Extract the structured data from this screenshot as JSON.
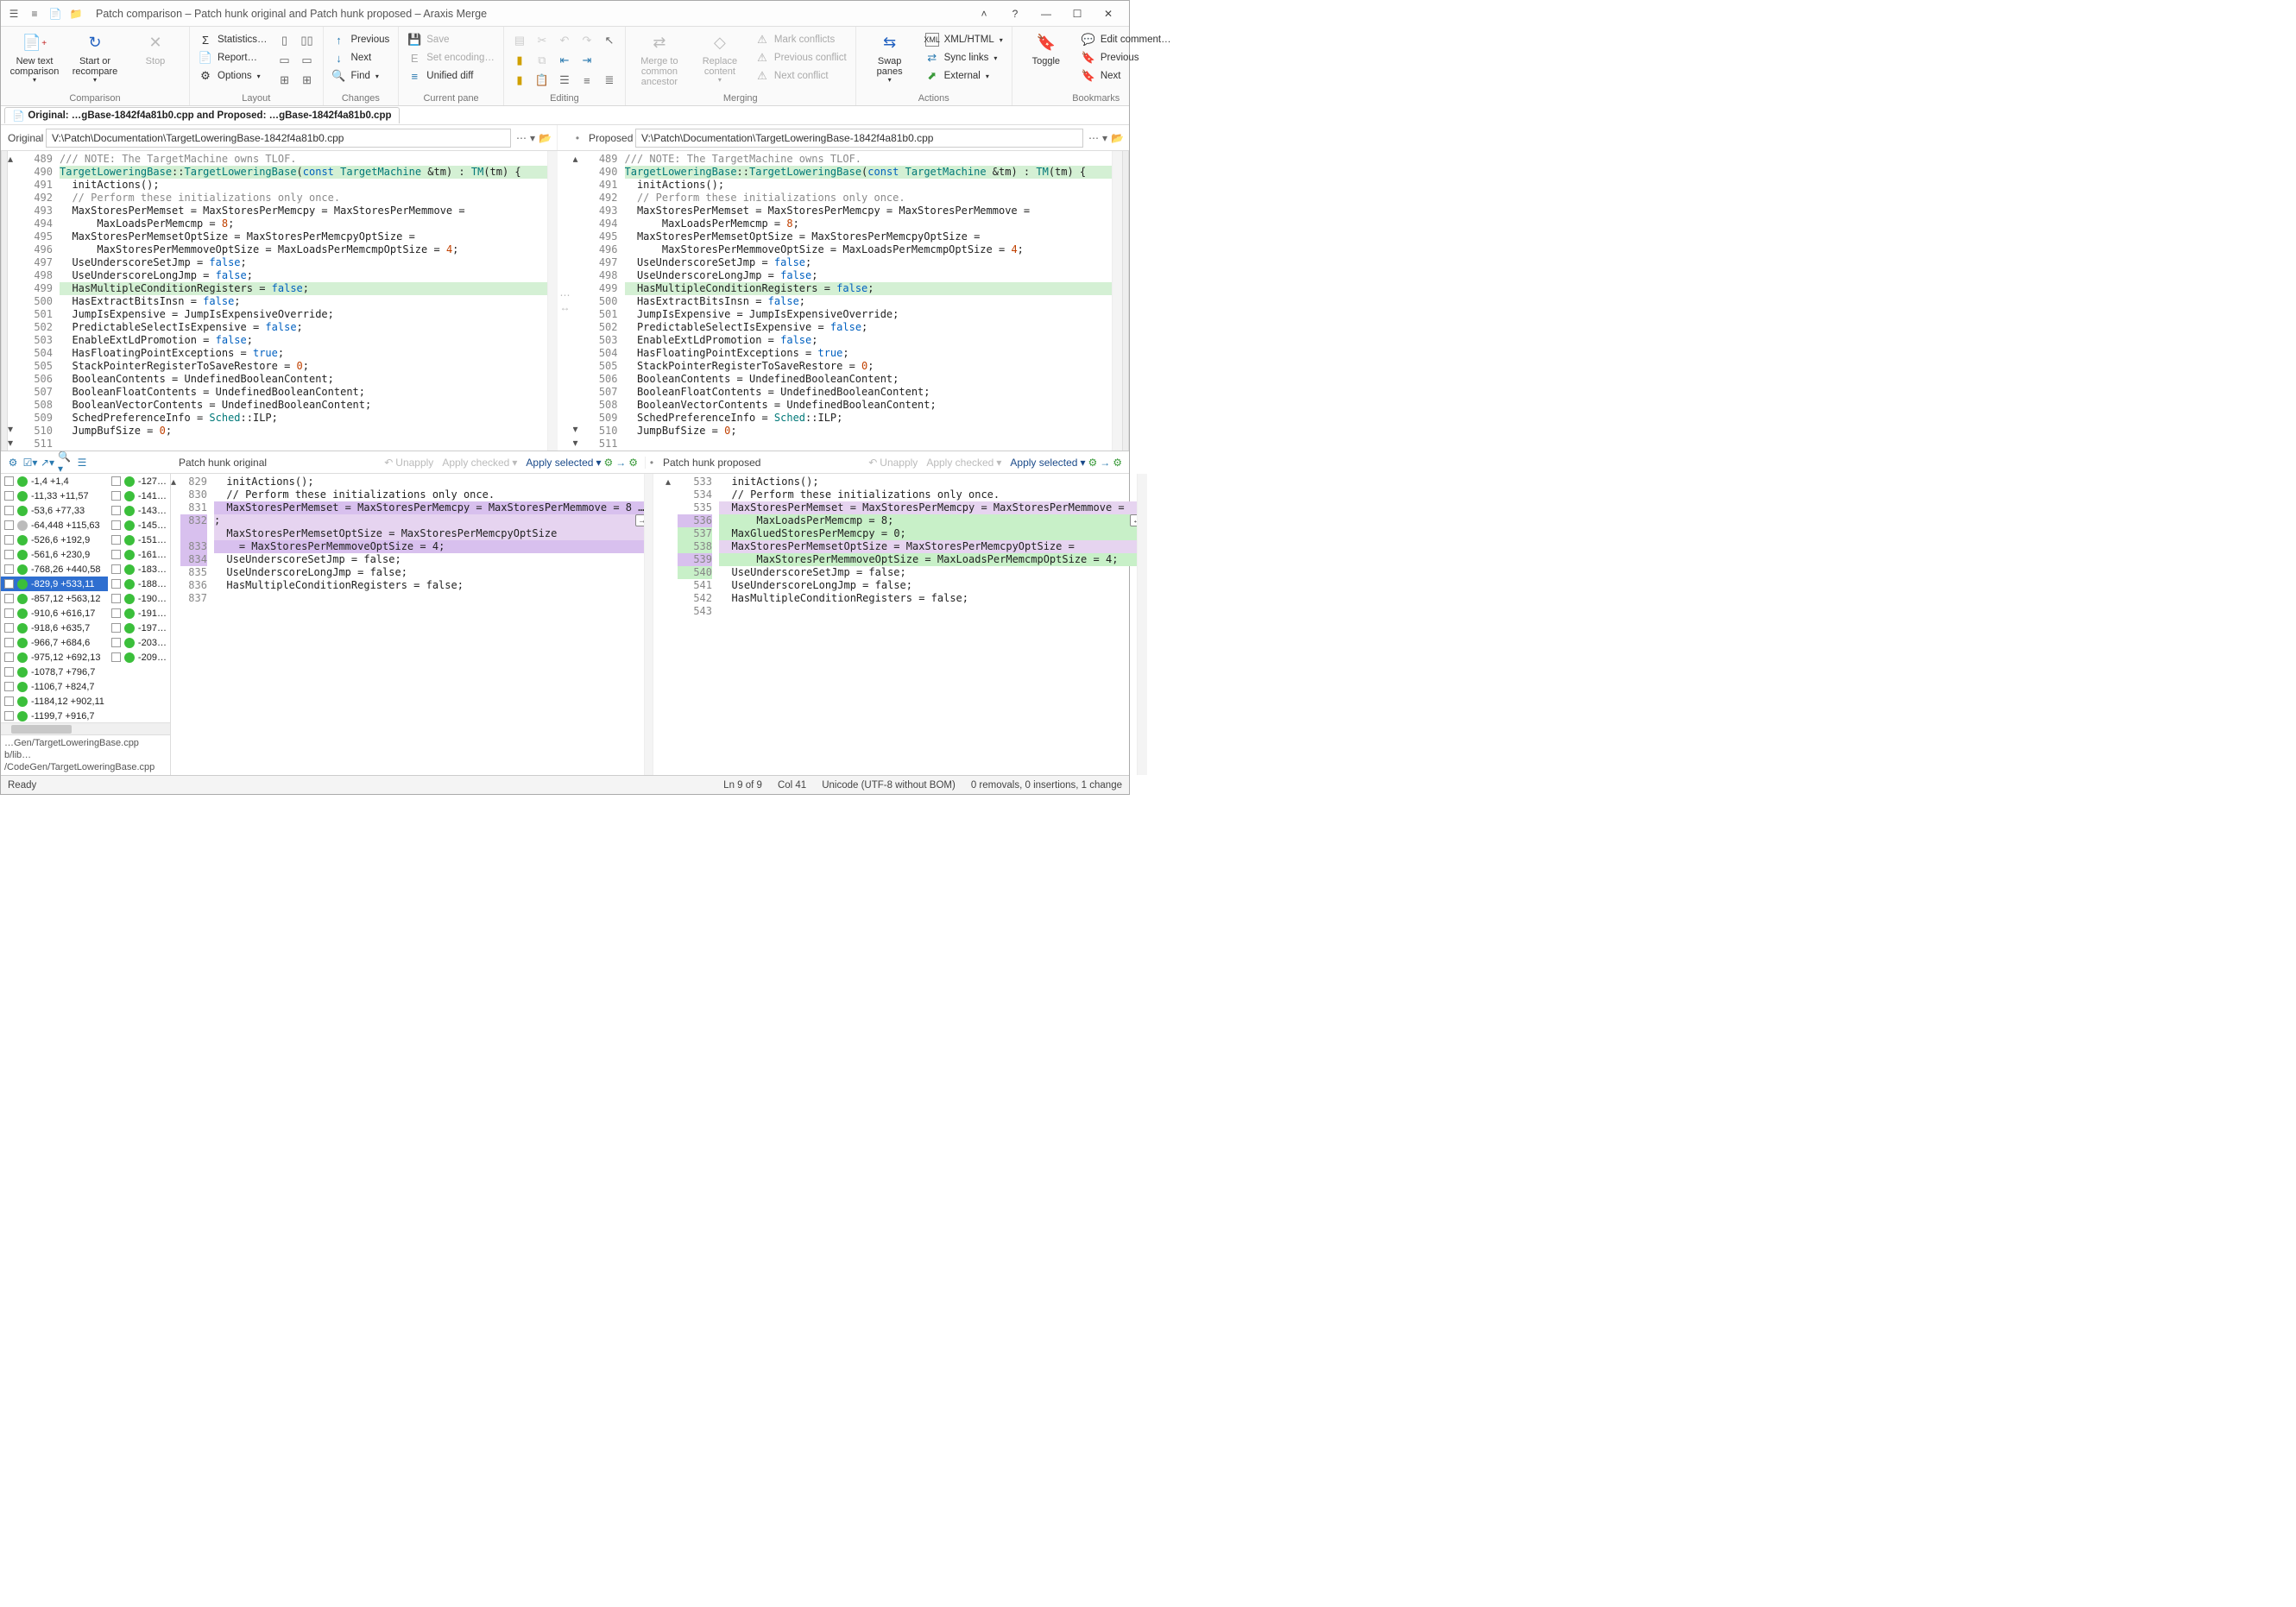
{
  "window_title": "Patch comparison – Patch hunk original and Patch hunk proposed – Araxis Merge",
  "ribbon": {
    "comparison": {
      "label": "Comparison",
      "new_text": "New text\ncomparison",
      "start_recompare": "Start or\nrecompare",
      "stop": "Stop"
    },
    "layout": {
      "label": "Layout",
      "statistics": "Statistics…",
      "report": "Report…",
      "options": "Options"
    },
    "changes": {
      "label": "Changes",
      "previous": "Previous",
      "next": "Next",
      "find": "Find"
    },
    "currentpane": {
      "label": "Current pane",
      "save": "Save",
      "set_encoding": "Set encoding…",
      "unified_diff": "Unified diff"
    },
    "editing": {
      "label": "Editing"
    },
    "merging": {
      "label": "Merging",
      "merge_common": "Merge to\ncommon ancestor",
      "replace_content": "Replace\ncontent",
      "mark_conflicts": "Mark conflicts",
      "previous_conflict": "Previous conflict",
      "next_conflict": "Next conflict"
    },
    "actions": {
      "label": "Actions",
      "swap_panes": "Swap\npanes",
      "xml_html": "XML/HTML",
      "sync_links": "Sync links",
      "external": "External"
    },
    "bookmarks": {
      "label": "Bookmarks",
      "toggle": "Toggle",
      "edit_comment": "Edit comment…",
      "previous": "Previous",
      "next": "Next"
    }
  },
  "doctab": "Original: …gBase-1842f4a81b0.cpp and Proposed: …gBase-1842f4a81b0.cpp",
  "paths": {
    "original_label": "Original",
    "original_path": "V:\\Patch\\Documentation\\TargetLoweringBase-1842f4a81b0.cpp",
    "proposed_label": "Proposed",
    "proposed_path": "V:\\Patch\\Documentation\\TargetLoweringBase-1842f4a81b0.cpp"
  },
  "code_left": {
    "start": 489,
    "lines": [
      {
        "n": 489,
        "t": "/// NOTE: The TargetMachine owns TLOF.",
        "cls": "cm"
      },
      {
        "n": 490,
        "t": "TargetLoweringBase::TargetLoweringBase(const TargetMachine &tm) : TM(tm) {",
        "cls": "hlgreen"
      },
      {
        "n": 491,
        "t": "  initActions();"
      },
      {
        "n": 492,
        "t": ""
      },
      {
        "n": 493,
        "t": "  // Perform these initializations only once.",
        "cls": "cm"
      },
      {
        "n": 494,
        "t": "  MaxStoresPerMemset = MaxStoresPerMemcpy = MaxStoresPerMemmove ="
      },
      {
        "n": 495,
        "t": "      MaxLoadsPerMemcmp = 8;"
      },
      {
        "n": 496,
        "t": "  MaxStoresPerMemsetOptSize = MaxStoresPerMemcpyOptSize ="
      },
      {
        "n": 497,
        "t": "      MaxStoresPerMemmoveOptSize = MaxLoadsPerMemcmpOptSize = 4;"
      },
      {
        "n": 498,
        "t": "  UseUnderscoreSetJmp = false;"
      },
      {
        "n": 499,
        "t": "  UseUnderscoreLongJmp = false;"
      },
      {
        "n": 500,
        "t": "  HasMultipleConditionRegisters = false;",
        "cls": "hlgreen"
      },
      {
        "n": 501,
        "t": "  HasExtractBitsInsn = false;"
      },
      {
        "n": 502,
        "t": "  JumpIsExpensive = JumpIsExpensiveOverride;"
      },
      {
        "n": 503,
        "t": "  PredictableSelectIsExpensive = false;"
      },
      {
        "n": 504,
        "t": "  EnableExtLdPromotion = false;"
      },
      {
        "n": 505,
        "t": "  HasFloatingPointExceptions = true;"
      },
      {
        "n": 506,
        "t": "  StackPointerRegisterToSaveRestore = 0;"
      },
      {
        "n": 507,
        "t": "  BooleanContents = UndefinedBooleanContent;"
      },
      {
        "n": 508,
        "t": "  BooleanFloatContents = UndefinedBooleanContent;"
      },
      {
        "n": 509,
        "t": "  BooleanVectorContents = UndefinedBooleanContent;"
      },
      {
        "n": 510,
        "t": "  SchedPreferenceInfo = Sched::ILP;"
      },
      {
        "n": 511,
        "t": "  JumpBufSize = 0;"
      }
    ]
  },
  "code_right": {
    "start": 489,
    "lines": [
      {
        "n": 489,
        "t": "/// NOTE: The TargetMachine owns TLOF.",
        "cls": "cm"
      },
      {
        "n": 490,
        "t": "TargetLoweringBase::TargetLoweringBase(const TargetMachine &tm) : TM(tm) {",
        "cls": "hlgreen"
      },
      {
        "n": 491,
        "t": "  initActions();"
      },
      {
        "n": 492,
        "t": ""
      },
      {
        "n": 493,
        "t": "  // Perform these initializations only once.",
        "cls": "cm"
      },
      {
        "n": 494,
        "t": "  MaxStoresPerMemset = MaxStoresPerMemcpy = MaxStoresPerMemmove ="
      },
      {
        "n": 495,
        "t": "      MaxLoadsPerMemcmp = 8;"
      },
      {
        "n": 496,
        "t": "  MaxStoresPerMemsetOptSize = MaxStoresPerMemcpyOptSize ="
      },
      {
        "n": 497,
        "t": "      MaxStoresPerMemmoveOptSize = MaxLoadsPerMemcmpOptSize = 4;"
      },
      {
        "n": 498,
        "t": "  UseUnderscoreSetJmp = false;"
      },
      {
        "n": 499,
        "t": "  UseUnderscoreLongJmp = false;"
      },
      {
        "n": 500,
        "t": "  HasMultipleConditionRegisters = false;",
        "cls": "hlgreen"
      },
      {
        "n": 501,
        "t": "  HasExtractBitsInsn = false;"
      },
      {
        "n": 502,
        "t": "  JumpIsExpensive = JumpIsExpensiveOverride;"
      },
      {
        "n": 503,
        "t": "  PredictableSelectIsExpensive = false;"
      },
      {
        "n": 504,
        "t": "  EnableExtLdPromotion = false;"
      },
      {
        "n": 505,
        "t": "  HasFloatingPointExceptions = true;"
      },
      {
        "n": 506,
        "t": "  StackPointerRegisterToSaveRestore = 0;"
      },
      {
        "n": 507,
        "t": "  BooleanContents = UndefinedBooleanContent;"
      },
      {
        "n": 508,
        "t": "  BooleanFloatContents = UndefinedBooleanContent;"
      },
      {
        "n": 509,
        "t": "  BooleanVectorContents = UndefinedBooleanContent;"
      },
      {
        "n": 510,
        "t": "  SchedPreferenceInfo = Sched::ILP;"
      },
      {
        "n": 511,
        "t": "  JumpBufSize = 0;"
      }
    ]
  },
  "hunkbar": {
    "left_title": "Patch hunk original",
    "right_title": "Patch hunk proposed",
    "unapply": "Unapply",
    "apply_checked": "Apply checked",
    "apply_selected": "Apply selected"
  },
  "hunks_left": [
    {
      "t": "-1,4 +1,4"
    },
    {
      "t": "-11,33 +11,57"
    },
    {
      "t": "-53,6 +77,33"
    },
    {
      "t": "-64,448 +115,63",
      "gray": true
    },
    {
      "t": "-526,6 +192,9"
    },
    {
      "t": "-561,6 +230,9"
    },
    {
      "t": "-768,26 +440,58"
    },
    {
      "t": "-829,9 +533,11",
      "sel": true
    },
    {
      "t": "-857,12 +563,12"
    },
    {
      "t": "-910,6 +616,17"
    },
    {
      "t": "-918,6 +635,7"
    },
    {
      "t": "-966,7 +684,6"
    },
    {
      "t": "-975,12 +692,13"
    },
    {
      "t": "-1078,7 +796,7"
    },
    {
      "t": "-1106,7 +824,7"
    },
    {
      "t": "-1184,12 +902,11"
    },
    {
      "t": "-1199,7 +916,7"
    }
  ],
  "hunks_right": [
    {
      "t": "-127…"
    },
    {
      "t": "-141…"
    },
    {
      "t": "-143…"
    },
    {
      "t": "-145…"
    },
    {
      "t": "-151…"
    },
    {
      "t": "-161…"
    },
    {
      "t": "-183…"
    },
    {
      "t": "-188…"
    },
    {
      "t": "-190…"
    },
    {
      "t": "-191…"
    },
    {
      "t": "-197…"
    },
    {
      "t": "-203…"
    },
    {
      "t": "-209…"
    }
  ],
  "hunk_paths": {
    "a": "…Gen/TargetLoweringBase.cpp b/lib…",
    "b": "/CodeGen/TargetLoweringBase.cpp"
  },
  "hunkcode_left": {
    "lines": [
      {
        "n": 829,
        "t": "  initActions();"
      },
      {
        "n": 830,
        "t": ""
      },
      {
        "n": 831,
        "t": "  // Perform these initializations only once.",
        "cls": "cm"
      },
      {
        "n": 832,
        "t": "  MaxStoresPerMemset = MaxStoresPerMemcpy = MaxStoresPerMemmove = 8 …",
        "hl": "hlpurple2"
      },
      {
        "n": "",
        "t": ";",
        "hl": "hlpurple"
      },
      {
        "n": 833,
        "t": "  MaxStoresPerMemsetOptSize = MaxStoresPerMemcpyOptSize",
        "hl": "hlpurple"
      },
      {
        "n": 834,
        "t": "    = MaxStoresPerMemmoveOptSize = 4;",
        "hl": "hlpurple2"
      },
      {
        "n": 835,
        "t": "  UseUnderscoreSetJmp = false;"
      },
      {
        "n": 836,
        "t": "  UseUnderscoreLongJmp = false;"
      },
      {
        "n": 837,
        "t": "  HasMultipleConditionRegisters = false;"
      }
    ]
  },
  "hunkcode_right": {
    "lines": [
      {
        "n": 533,
        "t": "  initActions();"
      },
      {
        "n": 534,
        "t": ""
      },
      {
        "n": 535,
        "t": "  // Perform these initializations only once.",
        "cls": "cm"
      },
      {
        "n": 536,
        "t": "  MaxStoresPerMemset = MaxStoresPerMemcpy = MaxStoresPerMemmove =",
        "hl": "hlpurple"
      },
      {
        "n": 537,
        "t": "      MaxLoadsPerMemcmp = 8;",
        "hl": "hladdgreen"
      },
      {
        "n": 538,
        "t": "  MaxGluedStoresPerMemcpy = 0;",
        "hl": "hladdgreen"
      },
      {
        "n": 539,
        "t": "  MaxStoresPerMemsetOptSize = MaxStoresPerMemcpyOptSize =",
        "hl": "hlpurple"
      },
      {
        "n": 540,
        "t": "      MaxStoresPerMemmoveOptSize = MaxLoadsPerMemcmpOptSize = 4;",
        "hl": "hladdgreen"
      },
      {
        "n": 541,
        "t": "  UseUnderscoreSetJmp = false;"
      },
      {
        "n": 542,
        "t": "  UseUnderscoreLongJmp = false;"
      },
      {
        "n": 543,
        "t": "  HasMultipleConditionRegisters = false;"
      }
    ]
  },
  "status": {
    "ready": "Ready",
    "ln": "Ln 9 of 9",
    "col": "Col 41",
    "encoding": "Unicode (UTF-8 without BOM)",
    "summary": "0 removals, 0 insertions, 1 change"
  }
}
